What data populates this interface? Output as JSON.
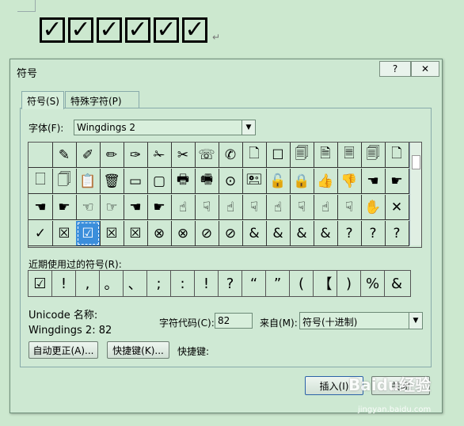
{
  "document": {
    "checks": [
      "✓",
      "✓",
      "✓",
      "✓",
      "✓",
      "✓"
    ],
    "para_mark": "↵"
  },
  "dialog": {
    "title": "符号",
    "help_button": "?",
    "close_button": "✕",
    "tabs": [
      {
        "label": "符号(S)"
      },
      {
        "label": "特殊字符(P)"
      }
    ],
    "font_label": "字体(F):",
    "font_value": "Wingdings 2",
    "symbols": [
      [
        "",
        "✎",
        "✐",
        "✏",
        "✑",
        "✁",
        "✂",
        "☏",
        "✆",
        "🗋",
        "☐",
        "🗐",
        "🗎",
        "🗏",
        "🗐",
        "🗋"
      ],
      [
        "🗌",
        "🗍",
        "📋",
        "🗑",
        "▭",
        "▢",
        "🖶",
        "🖷",
        "⊙",
        "🖭",
        "🔓",
        "🔒",
        "👍",
        "👎",
        "☚",
        "☛"
      ],
      [
        "☚",
        "☛",
        "☜",
        "☞",
        "☚",
        "☛",
        "☝",
        "☟",
        "☝",
        "☟",
        "☝",
        "☟",
        "☝",
        "☟",
        "✋",
        "✕"
      ],
      [
        "✓",
        "☒",
        "☑",
        "☒",
        "☒",
        "⊗",
        "⊗",
        "⊘",
        "⊘",
        "&",
        "&",
        "&",
        "&",
        "?",
        "?",
        "?"
      ]
    ],
    "selected_index": "3-2",
    "recent_label": "近期使用过的符号(R):",
    "recent": [
      "☑",
      "!",
      ",",
      "。",
      "、",
      ";",
      ":",
      "!",
      "?",
      "“",
      "”",
      "(",
      "【",
      ")",
      "%",
      "&"
    ],
    "unicode_name_label": "Unicode 名称:",
    "unicode_name_value": "Wingdings 2: 82",
    "char_code_label": "字符代码(C):",
    "char_code_value": "82",
    "from_label": "来自(M):",
    "from_value": "符号(十进制)",
    "autocorrect_button": "自动更正(A)...",
    "shortcut_button": "快捷键(K)...",
    "shortcut_label": "快捷键:",
    "insert_button": "插入(I)",
    "close_button2": "关闭"
  },
  "watermark": {
    "logo": "Baidu经验",
    "url": "jingyan.baidu.com"
  }
}
